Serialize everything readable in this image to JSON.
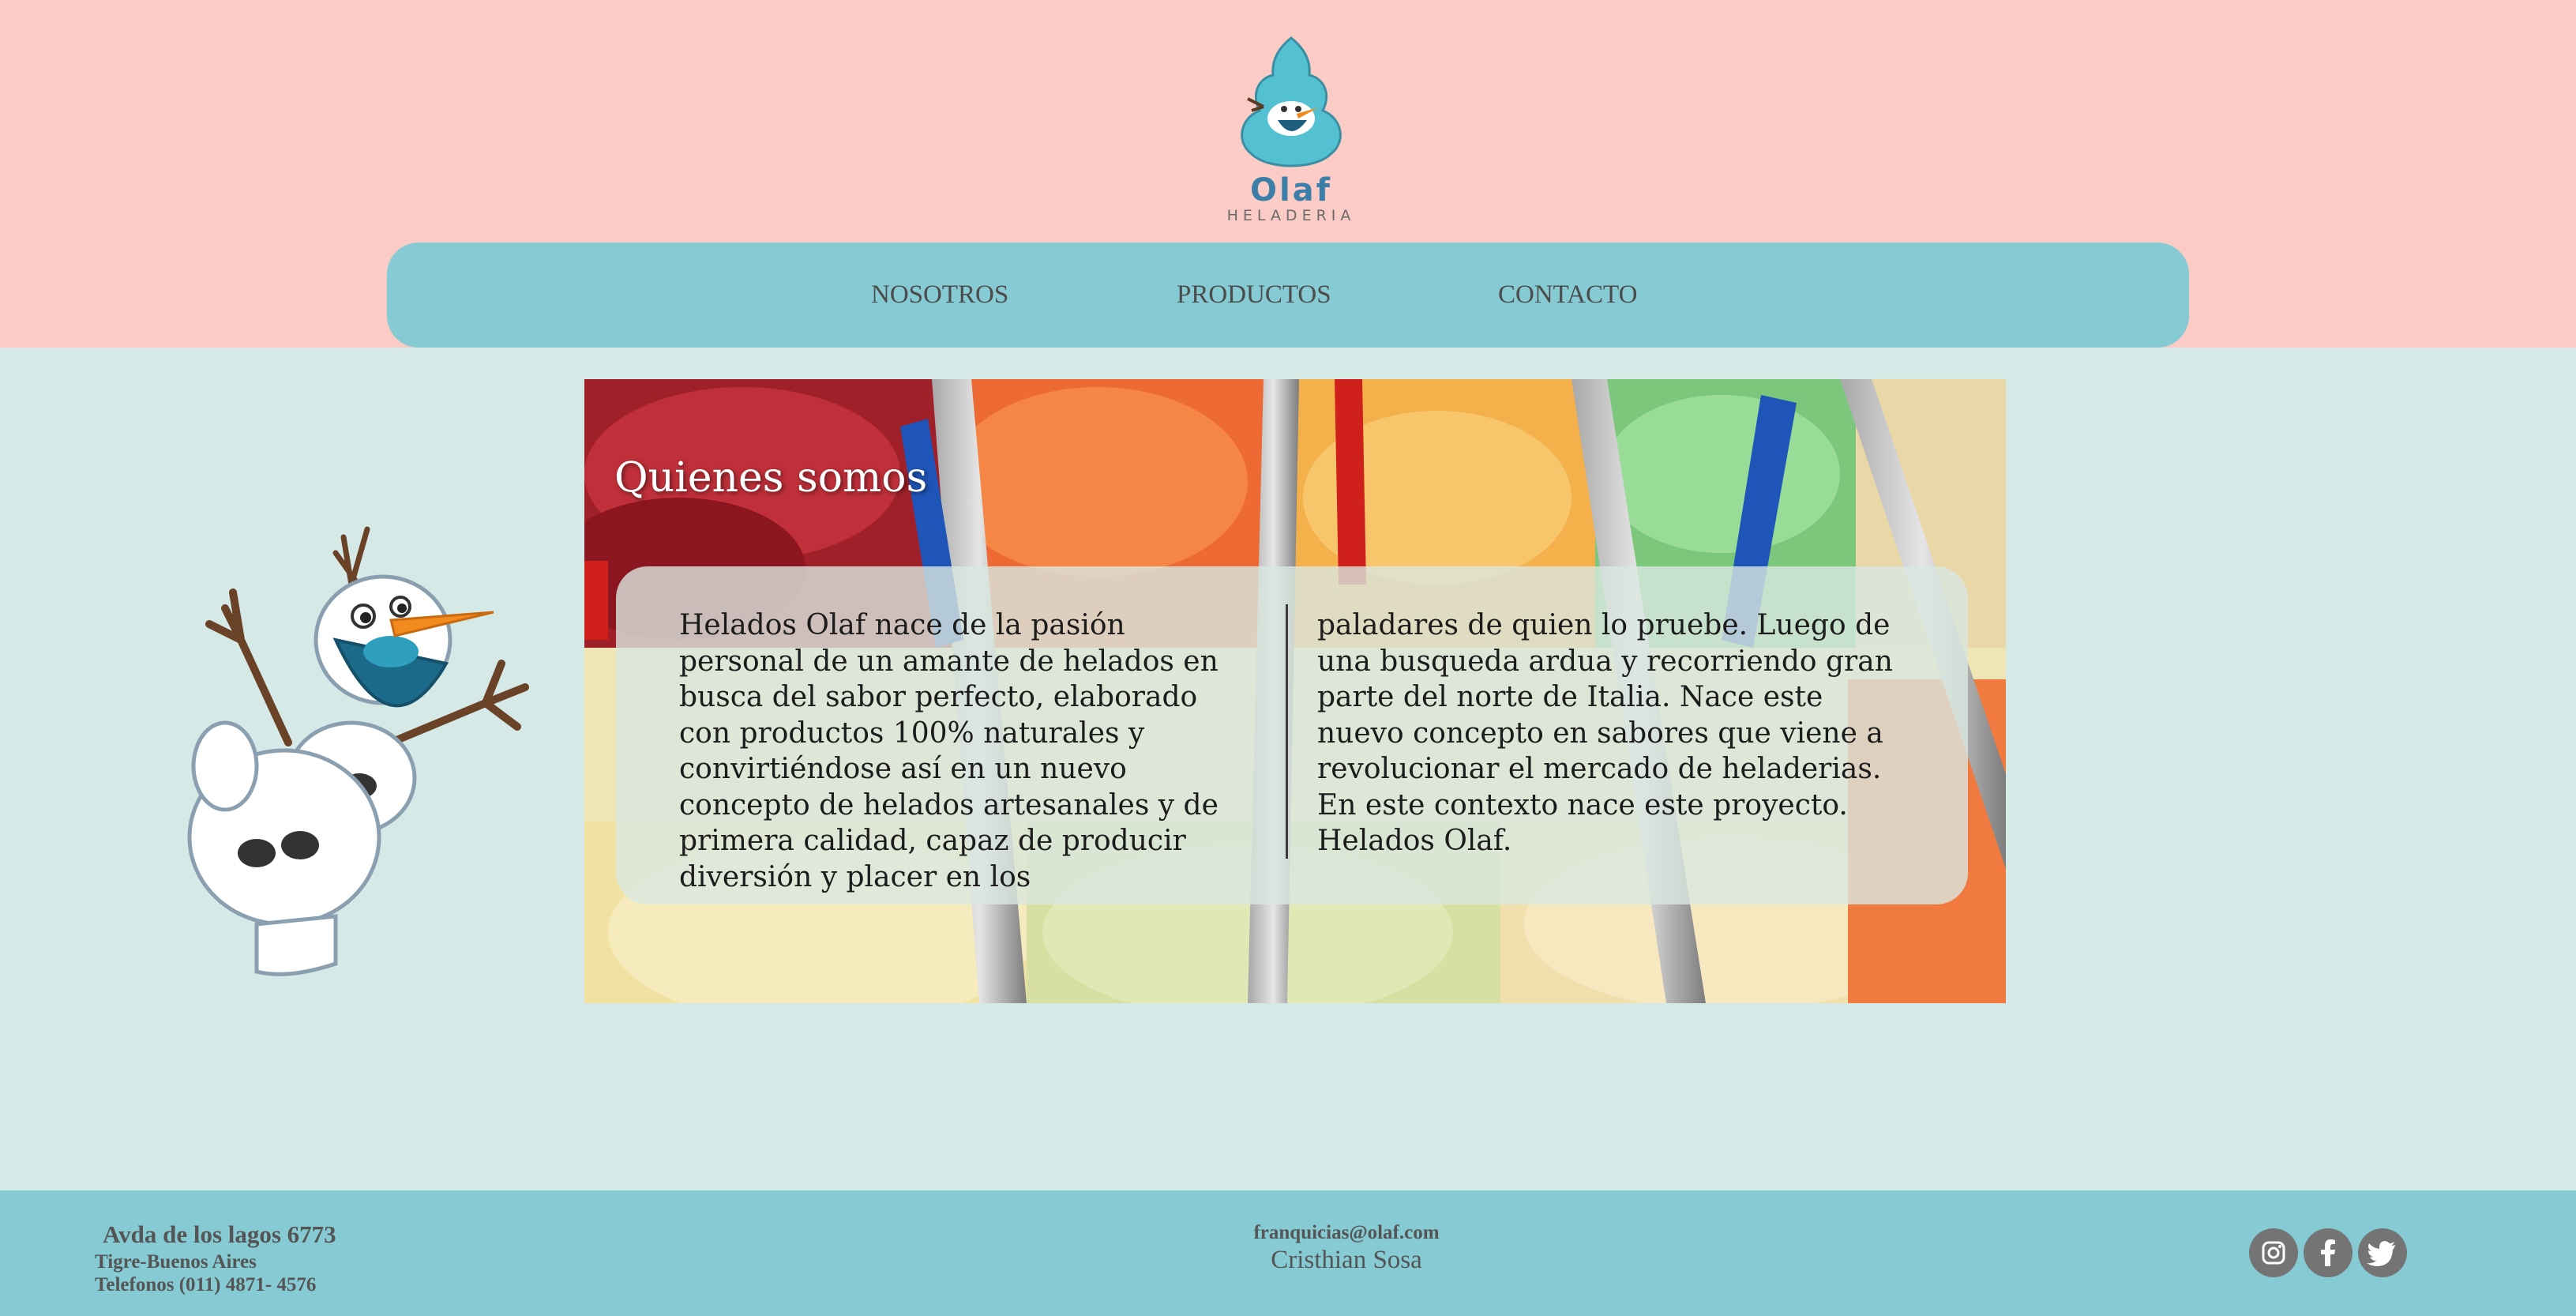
{
  "header": {
    "logo_name": "Olaf",
    "logo_sub": "HELADERIA"
  },
  "nav": {
    "items": [
      {
        "label": "NOSOTROS"
      },
      {
        "label": "PRODUCTOS"
      },
      {
        "label": "CONTACTO"
      }
    ]
  },
  "hero": {
    "title": "Quienes somos",
    "col1": "Helados Olaf nace de la pasión personal de un amante de helados en busca del sabor perfecto, elaborado con productos 100% naturales y convirtiéndose así en un nuevo concepto de helados artesanales y de primera calidad, capaz de producir diversión y placer en los",
    "col2": "paladares de quien lo pruebe. Luego de una busqueda ardua y recorriendo gran parte del norte de Italia. Nace este nuevo concepto en sabores que viene a revolucionar el mercado de heladerias. En este contexto nace este proyecto. Helados Olaf."
  },
  "footer": {
    "address_line1": "Avda de los lagos 6773",
    "address_line2": "Tigre-Buenos Aires",
    "phones": "Telefonos (011) 4871- 4576",
    "email": "franquicias@olaf.com",
    "owner": "Cristhian Sosa",
    "social": [
      {
        "icon": "instagram-icon"
      },
      {
        "icon": "facebook-icon"
      },
      {
        "icon": "twitter-icon"
      }
    ]
  },
  "colors": {
    "header_bg": "#fbcbc6",
    "nav_bg": "#86cbd3",
    "page_bg": "#d5e9e7",
    "footer_bg": "#86cbd3"
  }
}
